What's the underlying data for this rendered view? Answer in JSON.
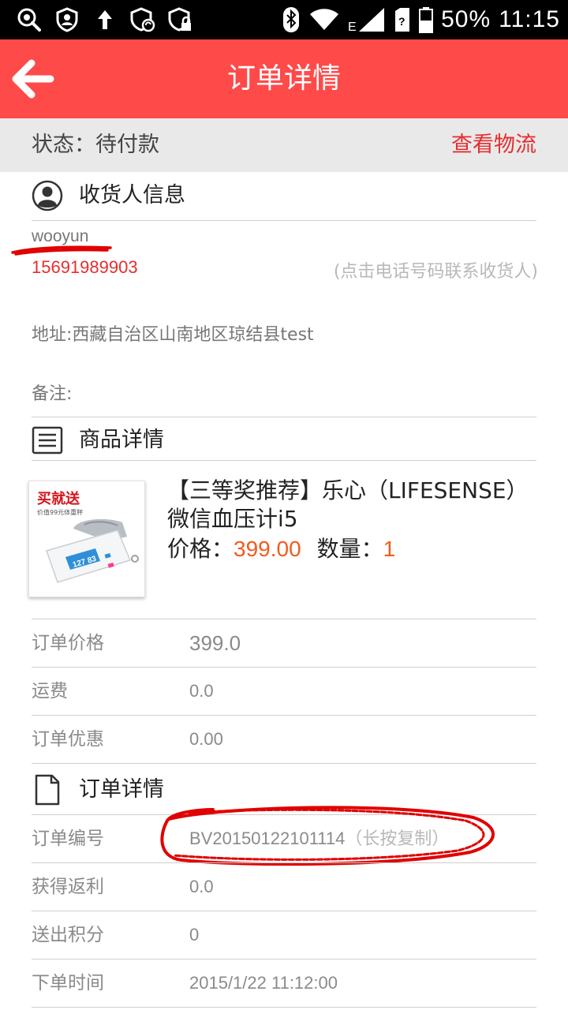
{
  "status_bar": {
    "battery": "50%",
    "time": "11:15",
    "network_type": "E",
    "icons": [
      "search-icon",
      "shield-user-icon",
      "upload-arrow-icon",
      "shield-sync-icon",
      "shield-lock-icon",
      "bluetooth-icon",
      "wifi-icon",
      "cell-signal-icon",
      "sim-icon",
      "battery-icon"
    ]
  },
  "header": {
    "title": "订单详情",
    "back_icon": "back-arrow-icon"
  },
  "order_status": {
    "status": "状态：待付款",
    "logistics_link": "查看物流"
  },
  "receiver": {
    "section_title": "收货人信息",
    "name": "wooyun",
    "phone": "15691989903",
    "phone_hint": "(点击电话号码联系收货人)",
    "address": "地址:西藏自治区山南地区琼结县test",
    "remark": "备注:"
  },
  "product": {
    "section_title": "商品详情",
    "image_badge": "买就送",
    "image_subtext": "价值99元体重秤",
    "name": "【三等奖推荐】乐心（LIFESENSE）微信血压计i5",
    "price_label": "价格：",
    "price": "399.00",
    "quantity_label": "数量：",
    "quantity": "1"
  },
  "costs": [
    {
      "label": "订单价格",
      "value": "399.0"
    },
    {
      "label": "运费",
      "value": "0.0"
    },
    {
      "label": "订单优惠",
      "value": "0.00"
    }
  ],
  "order_details": {
    "section_title": "订单详情",
    "order_no_label": "订单编号",
    "order_no": "BV20150122101114",
    "order_no_hint": "（长按复制）",
    "rebate_label": "获得返利",
    "rebate": "0.0",
    "points_label": "送出积分",
    "points": "0",
    "time_label": "下单时间",
    "time": "2015/1/22 11:12:00"
  },
  "colors": {
    "title_bar": "#ff4a4a",
    "accent_red": "#e62e2e",
    "price_orange": "#f25a1e",
    "status_bg": "#e9e9e9"
  }
}
